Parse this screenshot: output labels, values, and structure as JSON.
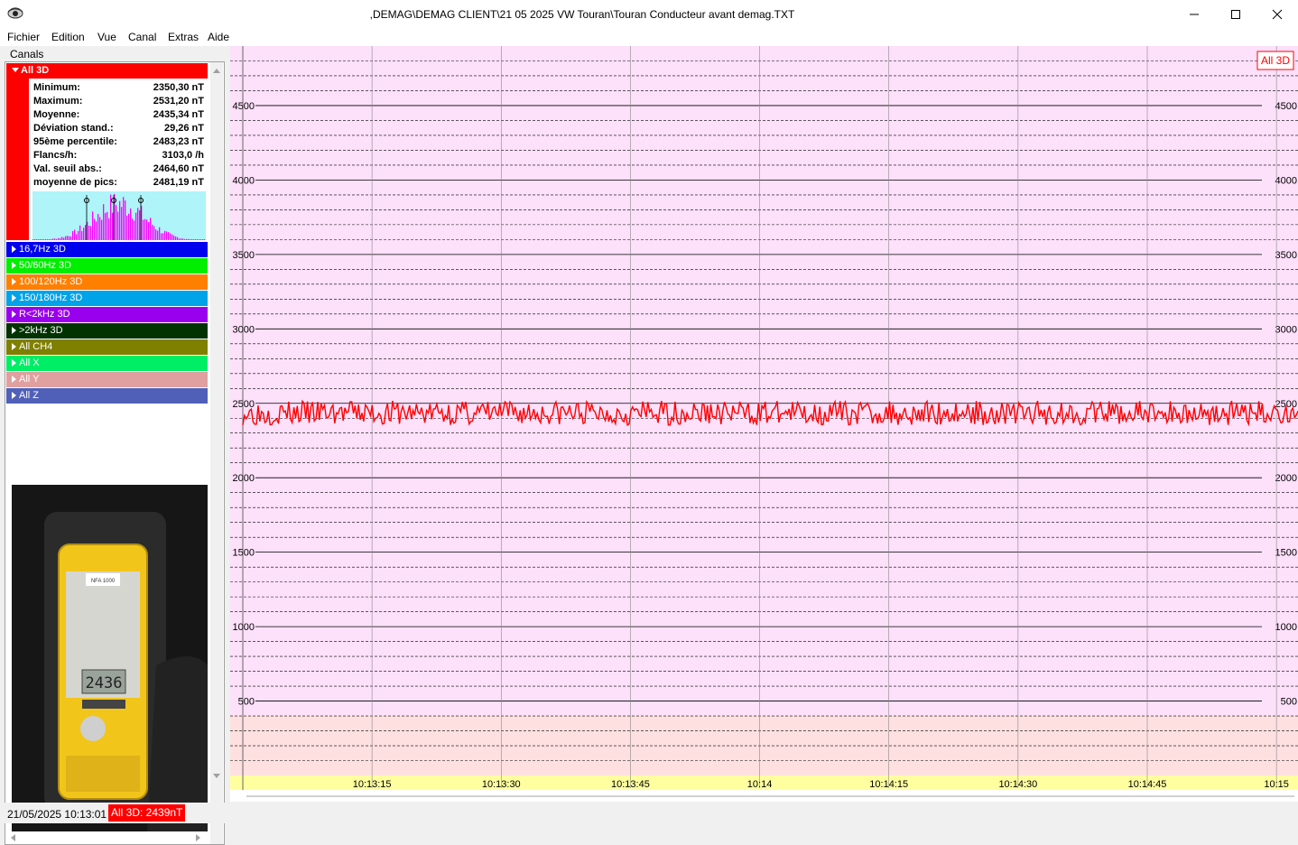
{
  "window": {
    "title": ",DEMAG\\DEMAG CLIENT\\21 05 2025 VW Touran\\Touran Conducteur avant demag.TXT"
  },
  "menu": [
    "Fichier",
    "Edition",
    "Vue",
    "Canal",
    "Extras",
    "Aide"
  ],
  "panel": {
    "title": "Canals",
    "expanded_channel": {
      "name": "All 3D",
      "color": "#ff0000",
      "stats": [
        {
          "label": "Minimum:",
          "value": "2350,30 nT"
        },
        {
          "label": "Maximum:",
          "value": "2531,20 nT"
        },
        {
          "label": "Moyenne:",
          "value": "2435,34 nT"
        },
        {
          "label": "Déviation stand.:",
          "value": "29,26 nT"
        },
        {
          "label": "95ème percentile:",
          "value": "2483,23 nT"
        },
        {
          "label": "Flancs/h:",
          "value": "3103,0 /h"
        },
        {
          "label": "Val. seuil abs.:",
          "value": "2464,60 nT"
        },
        {
          "label": "moyenne de pics:",
          "value": "2481,19 nT"
        }
      ]
    },
    "channels": [
      {
        "name": "16,7Hz 3D",
        "color": "#0000ee"
      },
      {
        "name": "50/60Hz 3D",
        "color": "#00ee00"
      },
      {
        "name": "100/120Hz 3D",
        "color": "#ff7f00"
      },
      {
        "name": "150/180Hz 3D",
        "color": "#00a2e8"
      },
      {
        "name": "R<2kHz 3D",
        "color": "#9900ee"
      },
      {
        "name": ">2kHz 3D",
        "color": "#003300"
      },
      {
        "name": "All CH4",
        "color": "#7f7f00"
      },
      {
        "name": "All X",
        "color": "#00ee66"
      },
      {
        "name": "All Y",
        "color": "#e0a0a0"
      },
      {
        "name": "All Z",
        "color": "#5060b8"
      }
    ],
    "photo": {
      "device_label": "NFA 1000",
      "display_reading": "2436"
    }
  },
  "chart_data": {
    "type": "line",
    "title": "",
    "legend": [
      "All 3D"
    ],
    "series": [
      {
        "name": "All 3D",
        "color": "#ff0000",
        "mean": 2435.34,
        "min": 2350.3,
        "max": 2531.2
      }
    ],
    "ylim": [
      0,
      4900
    ],
    "y_ticks": [
      500,
      1000,
      1500,
      2000,
      2500,
      3000,
      3500,
      4000,
      4500
    ],
    "y_tick_labels": [
      "500",
      "1000",
      "1500",
      "2000",
      "2500",
      "3000",
      "3500",
      "4000",
      "4500"
    ],
    "x_tick_labels": [
      "10:13:15",
      "10:13:30",
      "10:13:45",
      "10:14",
      "10:14:15",
      "10:14:30",
      "10:14:45",
      "10:15"
    ],
    "x_range_seconds": [
      0,
      122.5
    ],
    "x_tick_seconds": [
      15,
      30,
      45,
      60,
      75,
      90,
      105,
      120
    ],
    "grid": true,
    "background_zones": [
      {
        "from": 0,
        "to": 400,
        "color": "#ffe0e0"
      },
      {
        "from": 400,
        "to": 4900,
        "color": "#fde0fa"
      }
    ],
    "legend_position": "top-right"
  },
  "status": {
    "datetime": "21/05/2025 10:13:01",
    "badge": "All 3D: 2439nT"
  }
}
